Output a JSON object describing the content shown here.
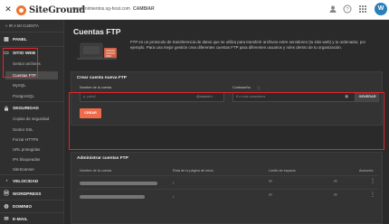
{
  "topbar": {
    "close_icon": "close-icon",
    "logo_text": "SiteGround",
    "domain": "mantenimientos.sg-host.com",
    "change_label": "CAMBIAR",
    "avatar_letter": "W",
    "icons": [
      "user-icon",
      "help-icon",
      "apps-grid-icon"
    ]
  },
  "sidebar": {
    "back_label": "« IR A MI CUENTA",
    "sections": [
      {
        "key": "panel",
        "icon": "grid-icon",
        "label": "PANEL"
      },
      {
        "key": "sitio-web",
        "icon": "web-icon",
        "label": "SITIO WEB"
      },
      {
        "key": "seguridad",
        "icon": "lock-icon",
        "label": "SEGURIDAD"
      },
      {
        "key": "velocidad",
        "icon": "speed-icon",
        "label": "VELOCIDAD"
      },
      {
        "key": "wordpress",
        "icon": "wordpress-icon",
        "label": "WORDPRESS"
      },
      {
        "key": "dominio",
        "icon": "globe-icon",
        "label": "DOMINIO"
      },
      {
        "key": "email",
        "icon": "mail-icon",
        "label": "E-MAIL"
      }
    ],
    "sitio_items": [
      "Gestor archivos",
      "Cuentas FTP",
      "MySQL",
      "PostgreSQL"
    ],
    "seguridad_items": [
      "Copias de seguridad",
      "Gestor SSL",
      "Forzar HTTPS",
      "URL protegidas",
      "IPs bloqueadas",
      "SiteScanner"
    ]
  },
  "main": {
    "title": "Cuentas FTP",
    "intro": "FTP es un protocolo de transferencia de datos que se utiliza para transferir archivos entre servidores (tu sitio web) y tu ordenador, por ejemplo. Para una mejor gestión crea diferentes cuentas FTP para diferentes usuarios y roles dentro de tu organización.",
    "create": {
      "title": "Crear cuenta nueva FTP",
      "account_label": "Nombre de la cuenta",
      "account_placeholder": "p. pdm2",
      "account_suffix": "@manteni...",
      "password_label": "Contraseña",
      "password_placeholder": "8 o más caracteres",
      "generate_label": "GENERAR",
      "create_label": "CREAR"
    },
    "manage": {
      "title": "Administrar cuentas FTP",
      "columns": [
        "Nombre de la cuenta",
        "Ruta de la página de inicio",
        "Límite de espacio",
        "Acciones"
      ],
      "rows": [
        {
          "path": "/",
          "quota": "∞"
        },
        {
          "path": "/",
          "quota": "∞"
        }
      ]
    }
  },
  "colors": {
    "accent": "#f06b4a",
    "highlight": "#e0262b",
    "sidebar_bg": "#2f2f2f",
    "main_bg": "#2a2a2a"
  }
}
